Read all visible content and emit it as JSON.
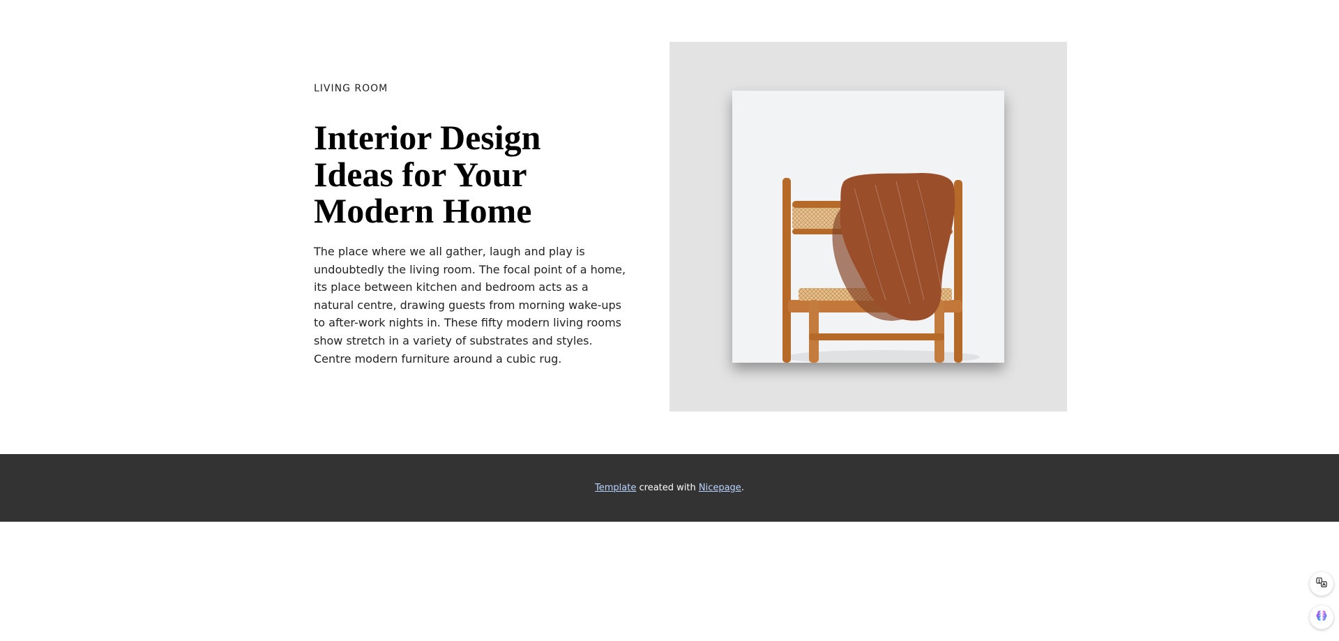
{
  "hero": {
    "kicker": "LIVING ROOM",
    "title": "Interior Design Ideas for Your Modern Home",
    "description": "The place where we all gather, laugh and play is undoubtedly the living room. The focal point of a home, its place between kitchen and bedroom acts as a natural centre, drawing guests from morning wake-ups to after-work nights in. These fifty modern living rooms show stretch in a variety of substrates and styles. Centre modern furniture around a cubic rug.",
    "image_alt": "wooden chair with rust knitted blanket"
  },
  "footer": {
    "link1": "Template",
    "mid": " created with ",
    "link2": "Nicepage",
    "end": "."
  },
  "floating": {
    "translate_icon": "translate-icon",
    "brain_icon": "brain-icon"
  },
  "colors": {
    "footer_bg": "#333333",
    "media_bg": "#e3e3e3",
    "photo_bg": "#f2f3f4",
    "link": "#b9d4ff",
    "chair_wood": "#b56a2a",
    "blanket": "#9b4e2a"
  }
}
